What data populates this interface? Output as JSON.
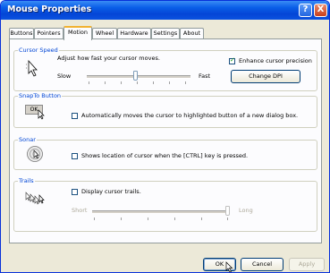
{
  "window": {
    "title": "Mouse Properties",
    "help": "?",
    "close": "X"
  },
  "tabs": [
    "Buttons",
    "Pointers",
    "Motion",
    "Wheel",
    "Hardware",
    "Settings",
    "About"
  ],
  "active_tab": "Motion",
  "cursor_speed": {
    "legend": "Cursor Speed",
    "description": "Adjust how fast your cursor moves.",
    "slow": "Slow",
    "fast": "Fast",
    "speed_level": 0.45,
    "enhance_label": "Enhance cursor precision",
    "enhance_checked": true,
    "change_dpi_label": "Change DPI"
  },
  "snapto": {
    "legend": "SnapTo Button",
    "icon_text": "OK",
    "label": "Automatically moves the cursor to highlighted button of a new dialog box.",
    "checked": false
  },
  "sonar": {
    "legend": "Sonar",
    "label": "Shows location of cursor when the [CTRL] key is pressed.",
    "checked": false
  },
  "trails": {
    "legend": "Trails",
    "label": "Display cursor trails.",
    "checked": false,
    "short": "Short",
    "long": "Long",
    "trail_level": 1.0
  },
  "footer": {
    "ok": "OK",
    "cancel": "Cancel",
    "apply": "Apply"
  },
  "colors": {
    "title_bar": "#0a5fe8",
    "legend": "#0046d5",
    "window_bg": "#ece9d8",
    "page_bg": "#fcfcfe"
  }
}
